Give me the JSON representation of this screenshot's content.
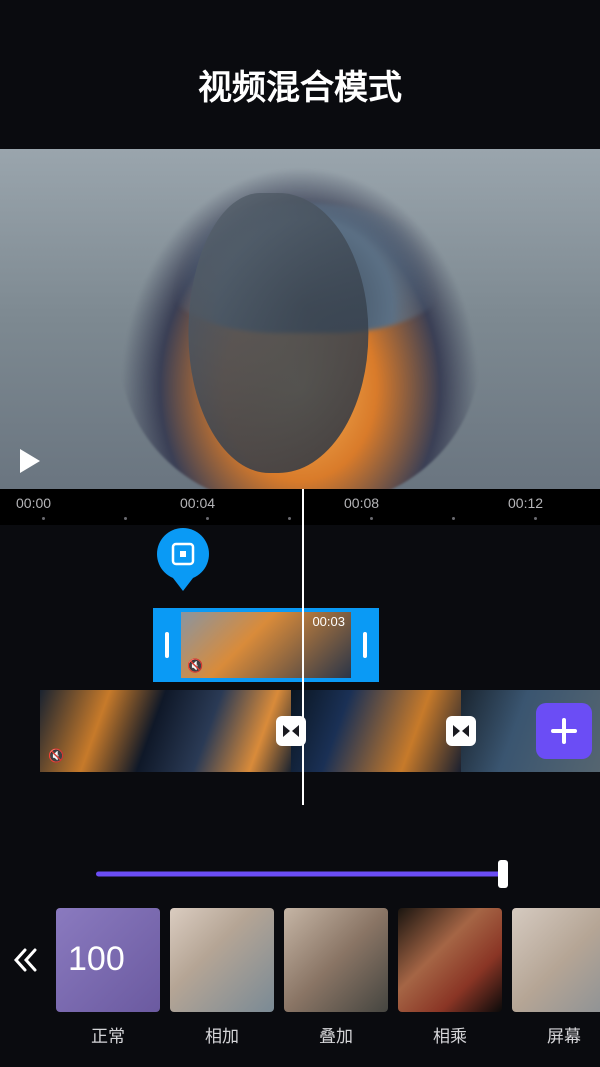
{
  "title": "视频混合模式",
  "ruler": {
    "ticks": [
      "00:00",
      "00:04",
      "00:08",
      "00:12"
    ]
  },
  "overlay_clip": {
    "duration": "00:03"
  },
  "slider": {
    "value": 100
  },
  "modes": {
    "selected_value": "100",
    "items": [
      {
        "label": "正常"
      },
      {
        "label": "相加"
      },
      {
        "label": "叠加"
      },
      {
        "label": "相乘"
      },
      {
        "label": "屏幕"
      }
    ]
  },
  "icons": {
    "mute": "🔇"
  }
}
